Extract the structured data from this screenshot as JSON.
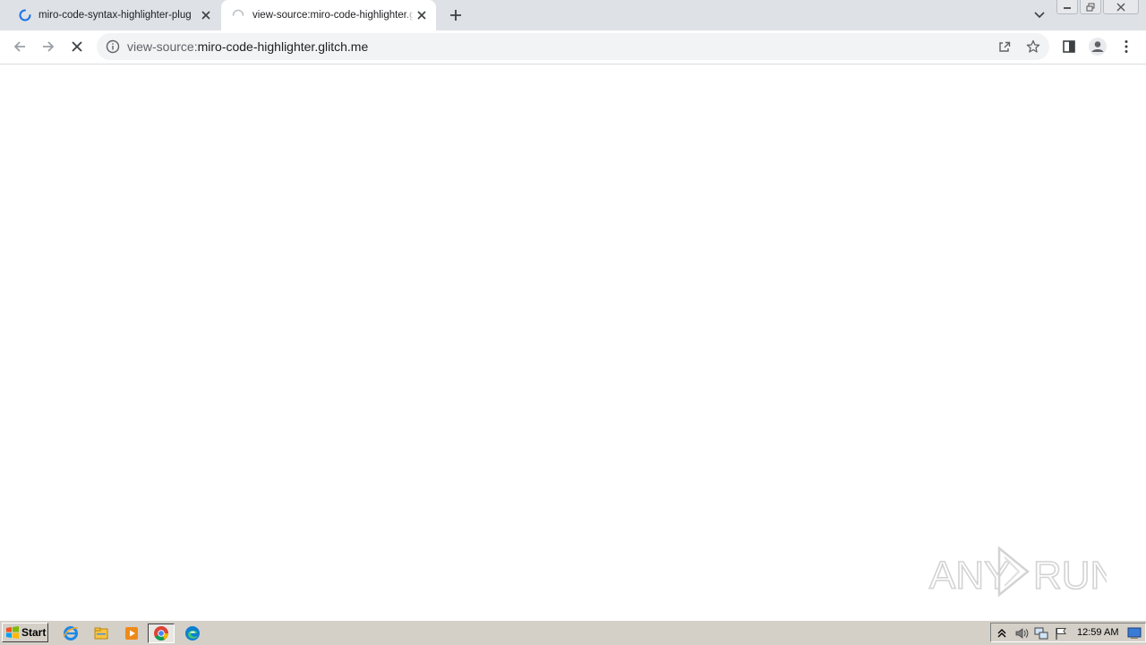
{
  "browser": {
    "tabs": [
      {
        "title": "miro-code-syntax-highlighter-plugin",
        "active": false,
        "loading": true
      },
      {
        "title": "view-source:miro-code-highlighter.glitch.me",
        "active": true,
        "loading": true
      }
    ],
    "address_bar": {
      "scheme": "view-source:",
      "host": "miro-code-highlighter.glitch.me"
    },
    "colors": {
      "accent": "#1a73e8",
      "tabstrip": "#dee1e6",
      "omnibox": "#f1f3f4"
    },
    "icons": {
      "back": "arrow-left-icon",
      "forward": "arrow-right-icon",
      "stop": "close-icon",
      "info": "info-icon",
      "share": "share-icon",
      "bookmark": "star-icon",
      "side_panel": "side-panel-icon",
      "profile": "profile-icon",
      "menu": "kebab-menu-icon"
    }
  },
  "watermark": {
    "text": "ANY RUN"
  },
  "taskbar": {
    "start_label": "Start",
    "clock": "12:59 AM",
    "quick_launch": [
      "internet-explorer-icon",
      "file-explorer-icon",
      "media-player-icon",
      "chrome-icon",
      "edge-icon"
    ],
    "tray": [
      "show-hidden-icon",
      "volume-icon",
      "network-icon",
      "action-center-flag-icon",
      "show-desktop-icon"
    ]
  }
}
